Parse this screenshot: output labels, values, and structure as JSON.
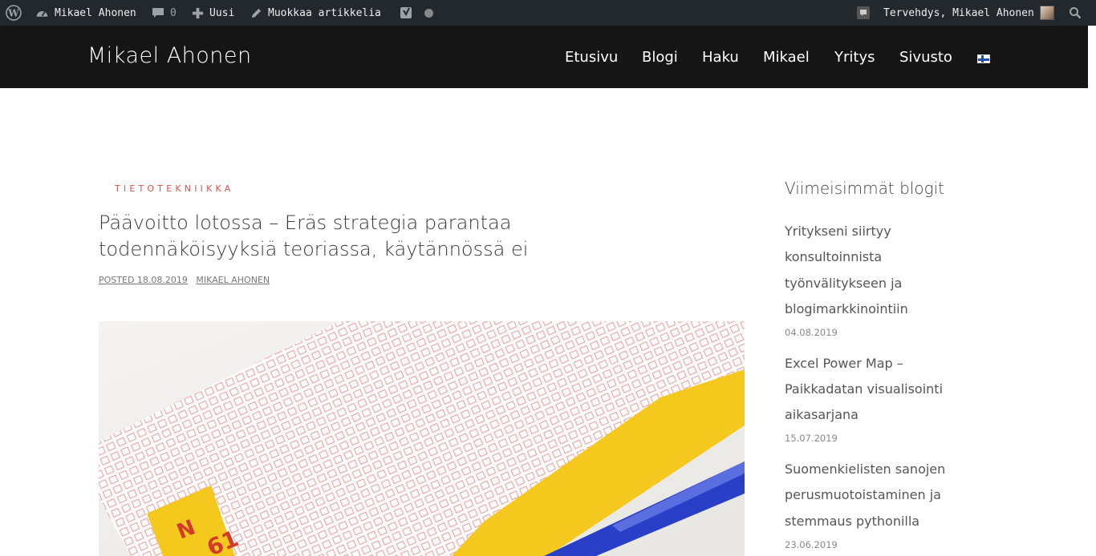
{
  "adminbar": {
    "site_name": "Mikael Ahonen",
    "comments_count": "0",
    "new_label": "Uusi",
    "edit_label": "Muokkaa artikkelia",
    "greeting": "Tervehdys, Mikael Ahonen",
    "icons": [
      "wordpress-icon",
      "dashboard-icon",
      "comment-icon",
      "plus-icon",
      "pencil-icon",
      "yoast-icon",
      "status-dot-icon",
      "notification-icon",
      "avatar",
      "search-icon"
    ]
  },
  "header": {
    "site_title": "Mikael Ahonen",
    "nav": [
      "Etusivu",
      "Blogi",
      "Haku",
      "Mikael",
      "Yritys",
      "Sivusto"
    ],
    "language_icon": "finnish-flag-icon"
  },
  "article": {
    "category": "TIETOTEKNIIKKA",
    "title_line1": "Päävoitto lotossa – Eräs strategia parantaa",
    "title_line2": "todennäköisyyksiä teoriassa, käytännössä ei",
    "posted": "POSTED 18.08.2019",
    "author": "MIKAEL AHONEN"
  },
  "sidebar": {
    "title": "Viimeisimmät blogit",
    "posts": [
      {
        "lines": [
          "Yritykseni siirtyy",
          "konsultoinnista",
          "työnvälitykseen ja",
          "blogimarkkinointiin"
        ],
        "date": "04.08.2019"
      },
      {
        "lines": [
          "Excel Power Map –",
          "Paikkadatan visualisointi",
          "aikasarjana"
        ],
        "date": "15.07.2019"
      },
      {
        "lines": [
          "Suomenkielisten sanojen",
          "perusmuotoistaminen ja",
          "stemmaus pythonilla"
        ],
        "date": "23.06.2019"
      }
    ]
  },
  "colors": {
    "adminbar_bg": "#23282d",
    "header_bg": "#151515",
    "category_accent": "#d9534f",
    "ticket_yellow": "#f5c81e",
    "pen_blue": "#2a3fc7"
  }
}
